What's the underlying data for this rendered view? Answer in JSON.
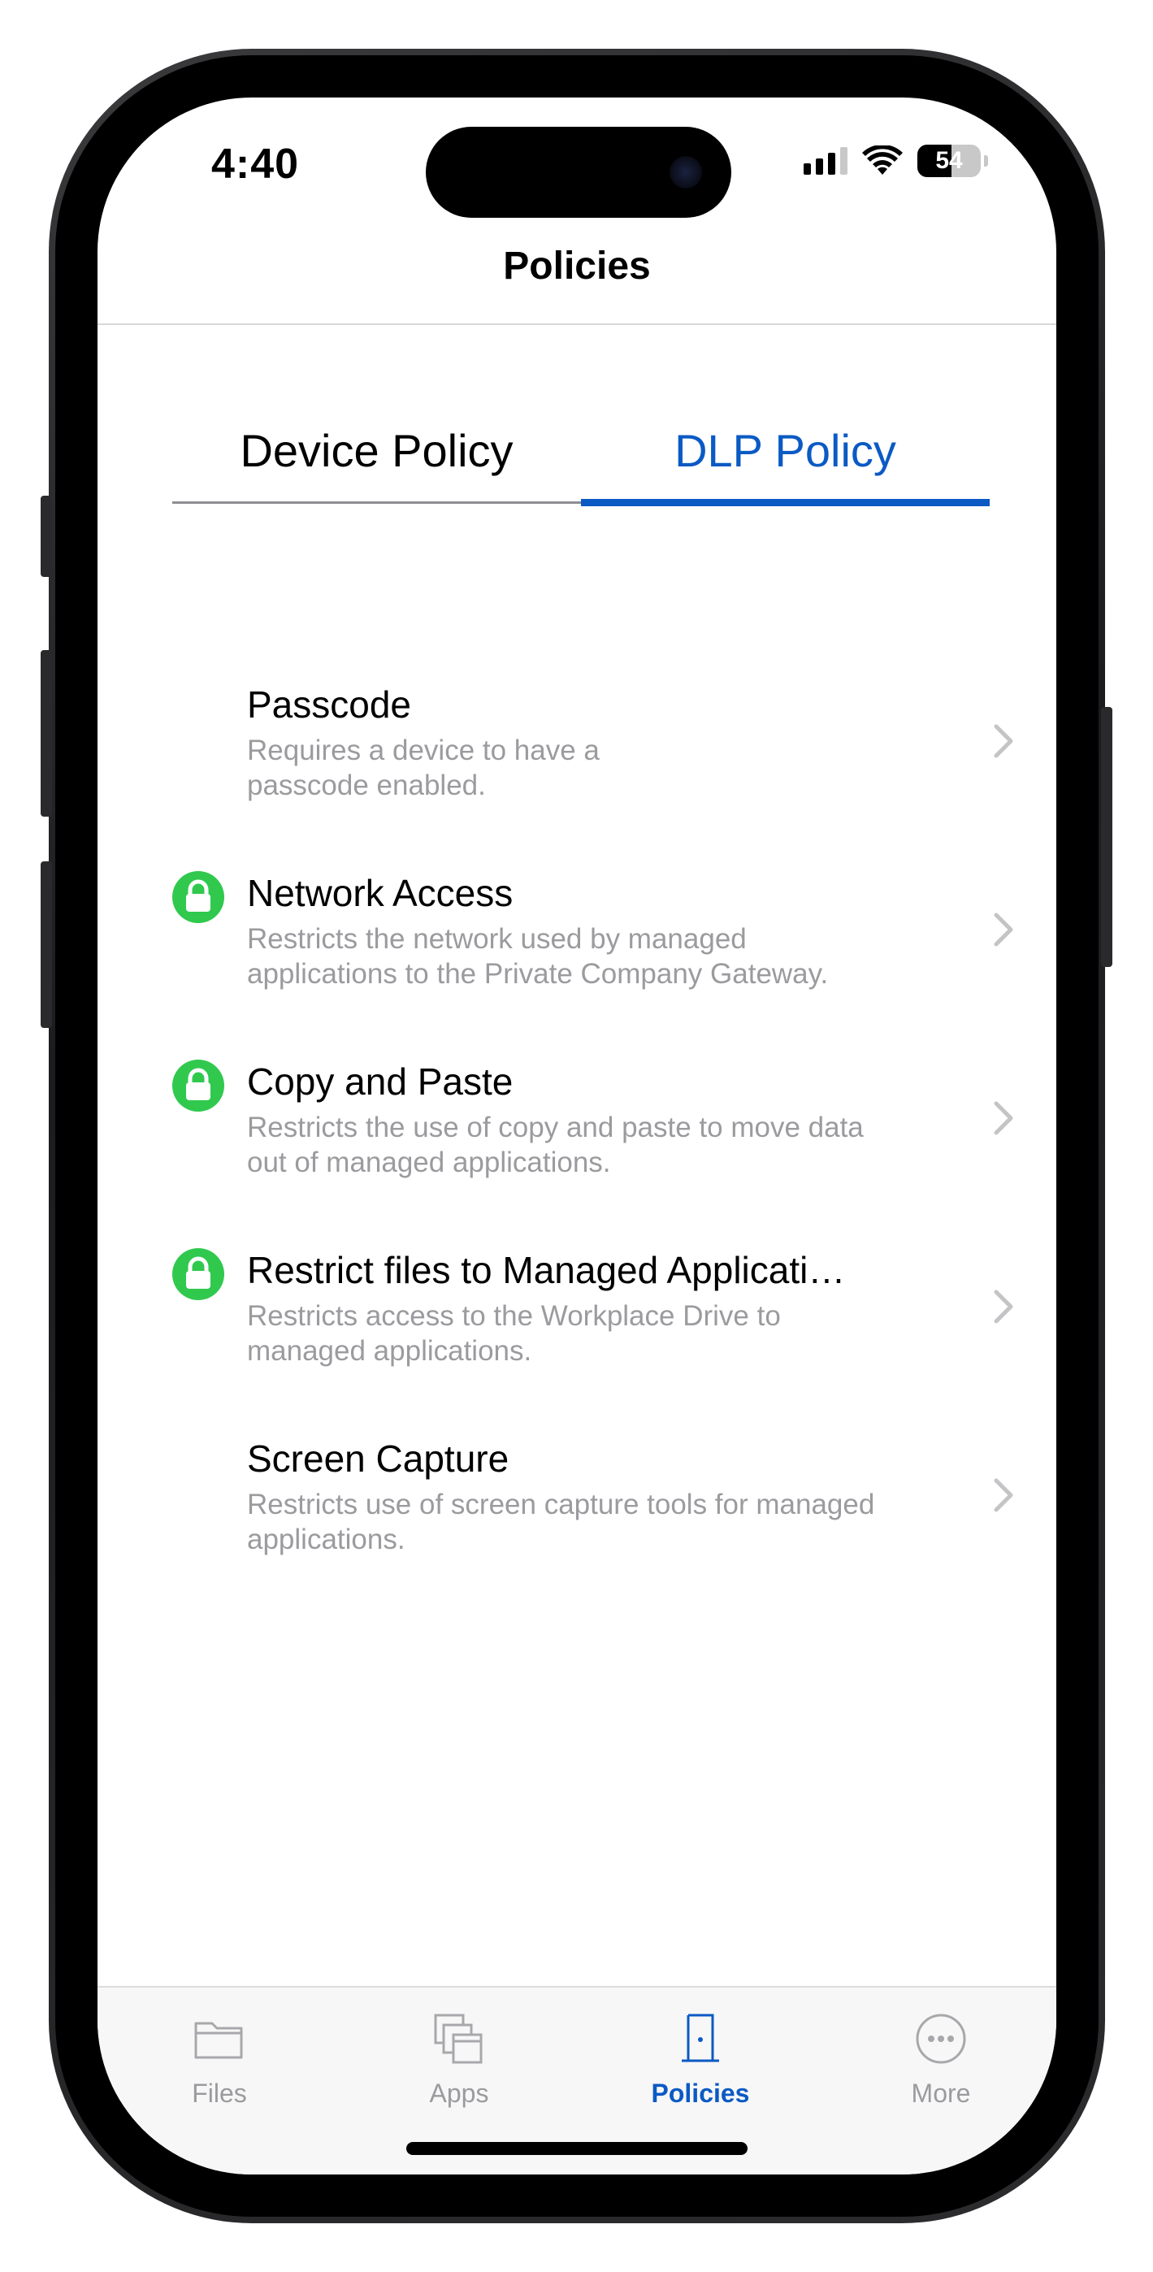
{
  "status_bar": {
    "time": "4:40",
    "battery_level": "54"
  },
  "nav": {
    "title": "Policies"
  },
  "tabs": [
    {
      "label": "Device Policy",
      "selected": false
    },
    {
      "label": "DLP Policy",
      "selected": true
    }
  ],
  "policies": [
    {
      "title": "Passcode",
      "description": "Requires a device to have a passcode enabled.",
      "locked": false
    },
    {
      "title": "Network Access",
      "description": "Restricts the network used by managed applications to the Private Company Gateway.",
      "locked": true
    },
    {
      "title": "Copy and Paste",
      "description": "Restricts the use of copy and paste to move data out of managed applications.",
      "locked": true
    },
    {
      "title": "Restrict files to Managed Applicati…",
      "description": "Restricts access to the Workplace Drive to managed applications.",
      "locked": true
    },
    {
      "title": "Screen Capture",
      "description": "Restricts use of screen capture tools for managed applications.",
      "locked": false
    }
  ],
  "tabbar": [
    {
      "label": "Files",
      "icon": "folder-icon",
      "active": false
    },
    {
      "label": "Apps",
      "icon": "apps-icon",
      "active": false
    },
    {
      "label": "Policies",
      "icon": "door-icon",
      "active": true
    },
    {
      "label": "More",
      "icon": "more-icon",
      "active": false
    }
  ],
  "colors": {
    "accent": "#0b5ac4",
    "lock_green": "#30c94e",
    "secondary_text": "#9b9b9f"
  }
}
